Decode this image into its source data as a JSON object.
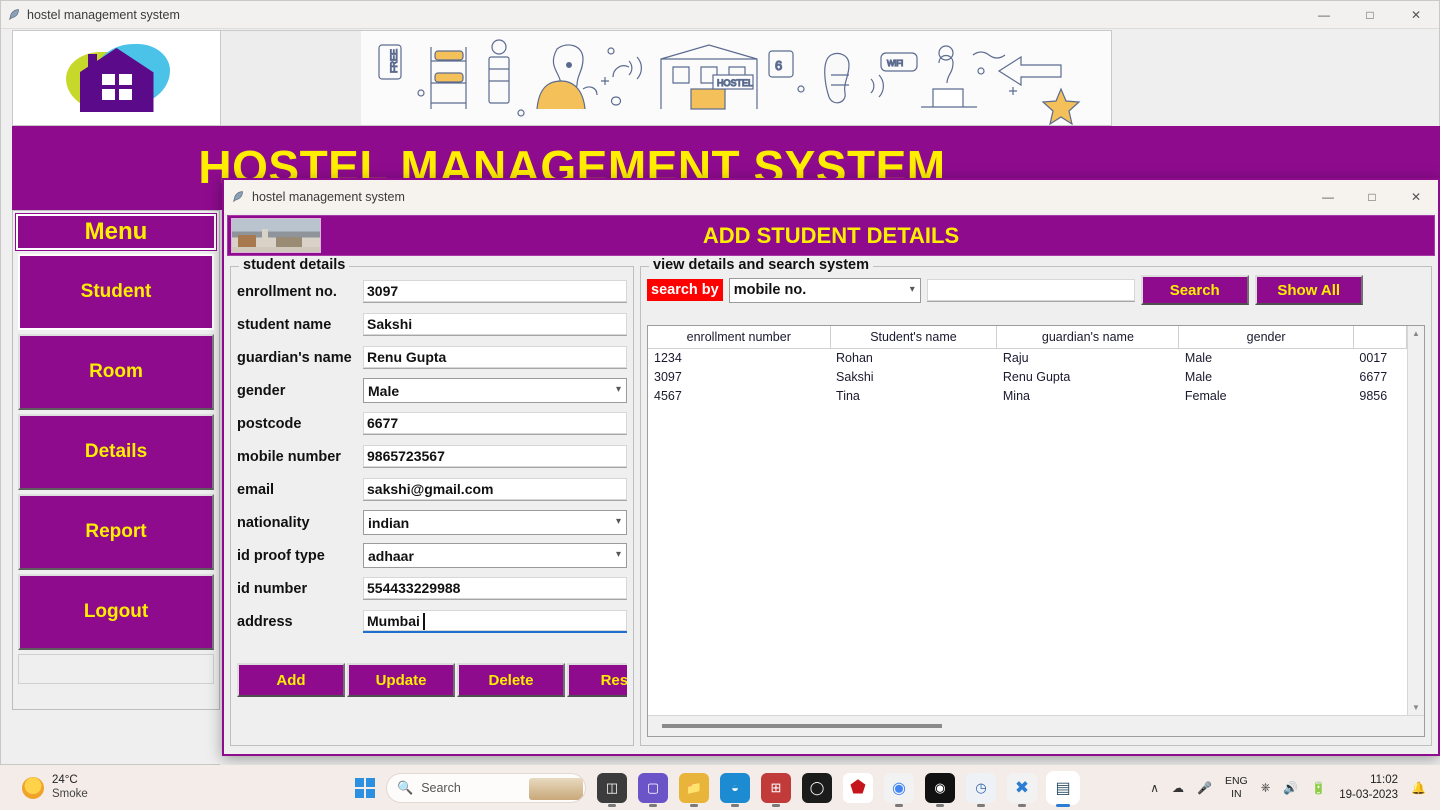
{
  "main_window": {
    "titlebar": {
      "icon": "feather-icon",
      "title": "hostel management system",
      "minimize": "—",
      "maximize": "□",
      "close": "✕"
    },
    "app_title": "HOSTEL MANAGEMENT SYSTEM",
    "logo_alt": "house-logo",
    "banner_alt": "hostel-doodle-banner",
    "menu": {
      "header": "Menu",
      "items": [
        {
          "label": "Student",
          "selected": true
        },
        {
          "label": "Room",
          "selected": false
        },
        {
          "label": "Details",
          "selected": false
        },
        {
          "label": "Report",
          "selected": false
        },
        {
          "label": "Logout",
          "selected": false
        }
      ]
    }
  },
  "dialog": {
    "titlebar": {
      "icon": "feather-icon",
      "title": "hostel management system",
      "minimize": "—",
      "maximize": "□",
      "close": "✕"
    },
    "header_title": "ADD STUDENT DETAILS",
    "header_image_alt": "campus-photo",
    "student_details": {
      "legend": "student details",
      "fields": [
        {
          "label": "enrollment no.",
          "type": "text",
          "value": "3097",
          "name": "enrollment-no"
        },
        {
          "label": "student name",
          "type": "text",
          "value": "Sakshi",
          "name": "student-name"
        },
        {
          "label": "guardian's name",
          "type": "text",
          "value": "Renu Gupta",
          "name": "guardian-name"
        },
        {
          "label": "gender",
          "type": "select",
          "value": "Male",
          "name": "gender"
        },
        {
          "label": "postcode",
          "type": "text",
          "value": "6677",
          "name": "postcode"
        },
        {
          "label": "mobile number",
          "type": "text",
          "value": "9865723567",
          "name": "mobile-number"
        },
        {
          "label": "email",
          "type": "text",
          "value": "sakshi@gmail.com",
          "name": "email"
        },
        {
          "label": "nationality",
          "type": "select",
          "value": "indian",
          "name": "nationality"
        },
        {
          "label": "id proof type",
          "type": "select",
          "value": "adhaar",
          "name": "id-proof-type"
        },
        {
          "label": "id number",
          "type": "text",
          "value": "554433229988",
          "name": "id-number"
        },
        {
          "label": "address",
          "type": "text",
          "value": "Mumbai",
          "name": "address",
          "focused": true
        }
      ],
      "buttons": [
        "Add",
        "Update",
        "Delete",
        "Reset"
      ]
    },
    "view_search": {
      "legend": "view details and search system",
      "search_by_label": "search by",
      "search_by_value": "mobile no.",
      "search_input_value": "",
      "search_button": "Search",
      "show_all_button": "Show All",
      "table": {
        "columns": [
          "enrollment number",
          "Student's name",
          "guardian's name",
          "gender",
          ""
        ],
        "rows": [
          [
            "1234",
            "Rohan",
            "Raju",
            "Male",
            "0017"
          ],
          [
            "3097",
            "Sakshi",
            "Renu Gupta",
            "Male",
            "6677"
          ],
          [
            "4567",
            "Tina",
            "Mina",
            "Female",
            "9856"
          ]
        ]
      }
    }
  },
  "taskbar": {
    "weather": {
      "temperature": "24°C",
      "condition": "Smoke"
    },
    "search_placeholder": "Search",
    "apps": [
      {
        "name": "task-view-icon",
        "glyph": "◱",
        "color": "#3c3c3c"
      },
      {
        "name": "teams-icon",
        "glyph": "▣",
        "color": "#6b54c8"
      },
      {
        "name": "file-explorer-icon",
        "glyph": "Ὓf",
        "color": "#e8b53a"
      },
      {
        "name": "edge-icon",
        "glyph": "◔",
        "color": "#1d8bd1"
      },
      {
        "name": "microsoft-store-icon",
        "glyph": "⊞",
        "color": "#c23b3b"
      },
      {
        "name": "dell-icon",
        "glyph": "◯",
        "color": "#1b1b1b"
      },
      {
        "name": "mcafee-icon",
        "glyph": "⬟",
        "color": "#c4161c"
      },
      {
        "name": "chrome-icon",
        "glyph": "●",
        "color": "#4285f4"
      },
      {
        "name": "whatsapp-icon",
        "glyph": "●",
        "color": "#111111"
      },
      {
        "name": "notebook-icon",
        "glyph": "◧",
        "color": "#2b5fa8"
      },
      {
        "name": "vscode-icon",
        "glyph": "✖",
        "color": "#2b7cd3"
      },
      {
        "name": "python-idle-icon",
        "glyph": "▤",
        "color": "#2d4f63"
      }
    ],
    "tray": {
      "chevron": "∧",
      "cloud": "☁",
      "mic": "Ἲ4",
      "wifi": "◠",
      "volume": "ὐa",
      "battery": "ὐb"
    },
    "language": {
      "line1": "ENG",
      "line2": "IN"
    },
    "clock": {
      "time": "11:02",
      "date": "19-03-2023"
    }
  },
  "colors": {
    "purple": "#8e0b8e",
    "yellow": "#ffee00",
    "red": "#ff0000",
    "focus_blue": "#1f6fd0"
  }
}
